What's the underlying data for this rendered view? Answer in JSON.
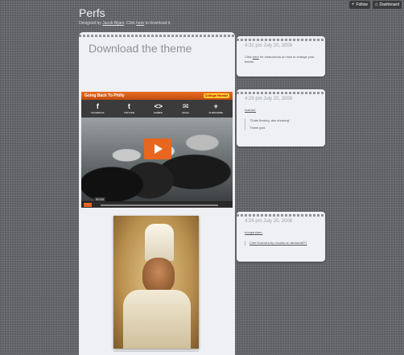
{
  "topbar": {
    "follow_label": "Follow",
    "dashboard_label": "Dashboard"
  },
  "header": {
    "title": "Perfs",
    "designed_by": "Designed by",
    "designer": "Jacob Bijani",
    "click": ". Click",
    "here": "here",
    "to_download": "to download it."
  },
  "main_post": {
    "title": "Download the theme",
    "video": {
      "title": "Going Back To Philly",
      "brand": "College Humor",
      "icons": [
        {
          "glyph": "f",
          "label": "FACEBOOK"
        },
        {
          "glyph": "t",
          "label": "TWITTER"
        },
        {
          "glyph": "<>",
          "label": "EMBED"
        },
        {
          "glyph": "✉",
          "label": "EMAIL"
        },
        {
          "glyph": "+",
          "label": "SUBSCRIBE"
        }
      ],
      "time": "00:00"
    }
  },
  "notes": [
    {
      "date": "4:32 pm July 20, 2008",
      "text_pre": "Click",
      "link": "here",
      "text_post": "for instructions on how to change your theme."
    },
    {
      "date": "4:29 pm July 20, 2008",
      "source": "malmei:",
      "quote": "\"Gutts flowing, abs showing\"",
      "reply": "Thank god."
    },
    {
      "date": "4:26 pm July 20, 2008",
      "source": "morganbam:",
      "caption_link": "Chef Guevera by ncooks on deviantART"
    }
  ]
}
